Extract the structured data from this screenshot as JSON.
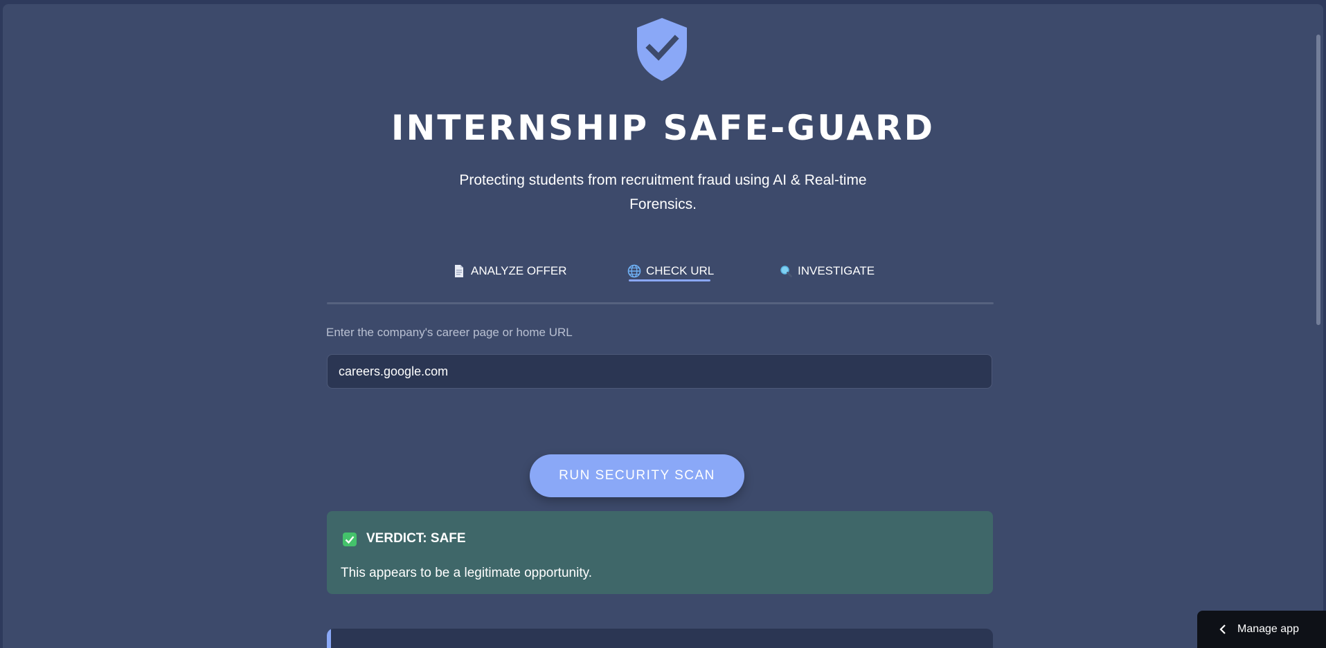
{
  "app": {
    "title": "INTERNSHIP SAFE-GUARD",
    "subtitle": "Protecting students from recruitment fraud using AI & Real-time Forensics."
  },
  "tabs": [
    {
      "label": "ANALYZE OFFER",
      "icon": "document-icon",
      "active": false
    },
    {
      "label": "CHECK URL",
      "icon": "globe-icon",
      "active": true
    },
    {
      "label": "INVESTIGATE",
      "icon": "magnifier-icon",
      "active": false
    }
  ],
  "url_check": {
    "label": "Enter the company's career page or home URL",
    "value": "careers.google.com",
    "scan_button": "RUN SECURITY SCAN"
  },
  "verdict": {
    "title": "VERDICT: SAFE",
    "message": "This appears to be a legitimate opportunity.",
    "status_color": "#3f6769",
    "icon": "checkmark-box-icon"
  },
  "manage_app": {
    "label": "Manage app",
    "icon": "chevron-left-icon"
  },
  "colors": {
    "accent": "#8aa8f7",
    "background": "#3d4a6b",
    "input_bg": "#2b3653",
    "safe": "#44c26b"
  }
}
